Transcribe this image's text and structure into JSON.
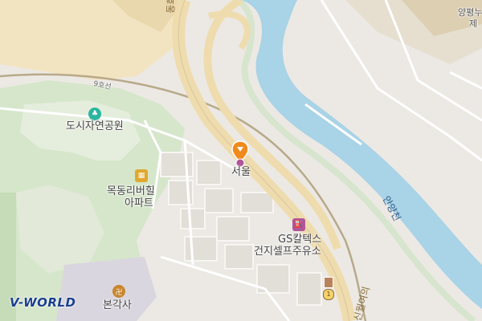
{
  "map": {
    "labels": {
      "park": "도시자연공원",
      "apt_line1": "목동리버힐",
      "apt_line2": "아파트",
      "marker_label": "서울",
      "gas_line1": "GS칼텍스",
      "gas_line2": "건지셀프주유소",
      "temple": "본각사",
      "river": "안양천",
      "rail": "9호선",
      "top_right_line1": "양평누",
      "top_right_line2": "제",
      "road_top": "동화",
      "road_bottom": "신월여의",
      "route_number": "1"
    },
    "colors": {
      "river": "#a9d3e6",
      "park": "#cfe3c4",
      "expressway": "#f3e2b8",
      "marker": "#f08a1c",
      "poi_park": "#2bb5a0",
      "poi_apt": "#e0a82e",
      "poi_gas": "#b0559a",
      "poi_temple": "#c8862c"
    },
    "icons": [
      "park-icon",
      "apartment-icon",
      "gas-station-icon",
      "temple-icon",
      "location-pin-icon",
      "route-shield-icon"
    ]
  },
  "branding": {
    "logo": "V-WORLD"
  }
}
